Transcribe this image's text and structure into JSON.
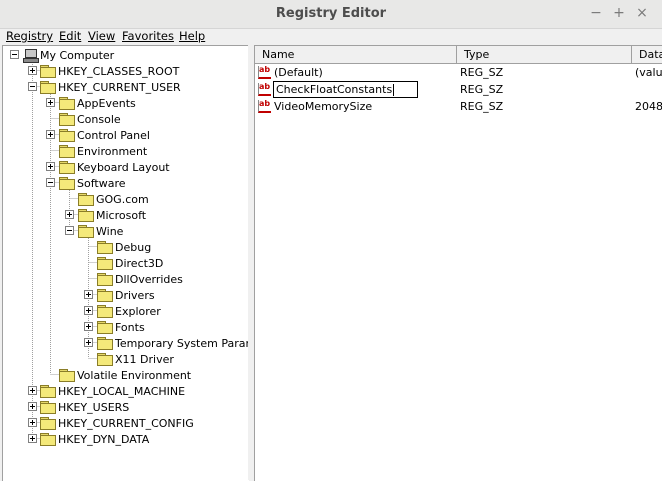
{
  "window": {
    "title": "Registry Editor",
    "controls": {
      "minimize": "−",
      "maximize": "+",
      "close": "×"
    }
  },
  "menu": [
    {
      "label": "Registry"
    },
    {
      "label": "Edit"
    },
    {
      "label": "View"
    },
    {
      "label": "Favorites"
    },
    {
      "label": "Help"
    }
  ],
  "tree": {
    "nodes": [
      {
        "label": "My Computer",
        "expanded": true,
        "icon": "computer-icon"
      },
      {
        "label": "HKEY_CLASSES_ROOT",
        "expanded": false
      },
      {
        "label": "HKEY_CURRENT_USER",
        "expanded": true
      },
      {
        "label": "AppEvents",
        "expanded": false
      },
      {
        "label": "Console"
      },
      {
        "label": "Control Panel",
        "expanded": false
      },
      {
        "label": "Environment"
      },
      {
        "label": "Keyboard Layout",
        "expanded": false
      },
      {
        "label": "Software",
        "expanded": true
      },
      {
        "label": "GOG.com"
      },
      {
        "label": "Microsoft",
        "expanded": false
      },
      {
        "label": "Wine",
        "expanded": true
      },
      {
        "label": "Debug"
      },
      {
        "label": "Direct3D",
        "selected": true
      },
      {
        "label": "DllOverrides"
      },
      {
        "label": "Drivers",
        "expanded": false
      },
      {
        "label": "Explorer",
        "expanded": false
      },
      {
        "label": "Fonts",
        "expanded": false
      },
      {
        "label": "Temporary System Paramet",
        "expanded": false
      },
      {
        "label": "X11 Driver"
      },
      {
        "label": "Volatile Environment"
      },
      {
        "label": "HKEY_LOCAL_MACHINE",
        "expanded": false
      },
      {
        "label": "HKEY_USERS",
        "expanded": false
      },
      {
        "label": "HKEY_CURRENT_CONFIG",
        "expanded": false
      },
      {
        "label": "HKEY_DYN_DATA",
        "expanded": false
      }
    ]
  },
  "list": {
    "columns": [
      "Name",
      "Type",
      "Data"
    ],
    "rows": [
      {
        "name": "(Default)",
        "type": "REG_SZ",
        "data": "(valu",
        "icon": "string-value-icon"
      },
      {
        "name": "CheckFloatConstants",
        "type": "REG_SZ",
        "data": "",
        "icon": "string-value-icon",
        "editing": true
      },
      {
        "name": "VideoMemorySize",
        "type": "REG_SZ",
        "data": "2048",
        "icon": "string-value-icon"
      }
    ]
  }
}
